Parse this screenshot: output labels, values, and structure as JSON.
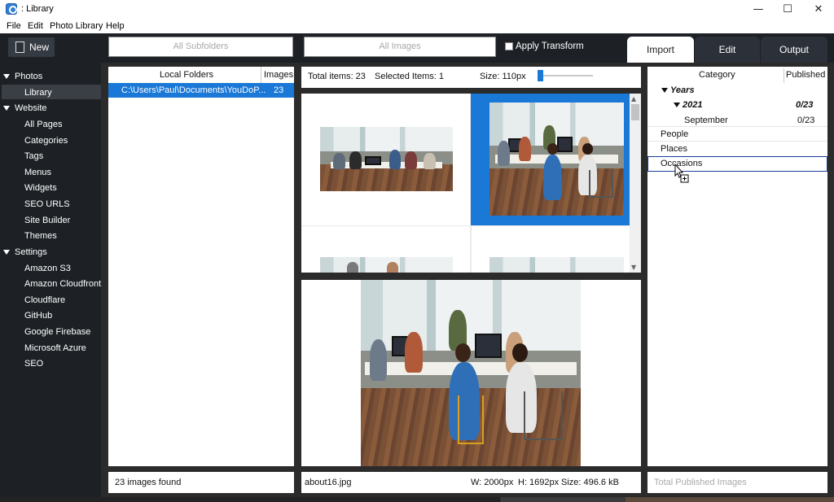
{
  "window": {
    "title": ": Library",
    "minimize": "—",
    "maximize": "☐",
    "close": "✕"
  },
  "menu": [
    "File",
    "Edit",
    "Photo Library",
    "Help"
  ],
  "toolbar": {
    "new_label": "New",
    "subfolders_placeholder": "All Subfolders",
    "images_placeholder": "All Images",
    "apply_transform_label": "Apply Transform",
    "apply_transform_checked": false,
    "tabs": [
      {
        "label": "Import",
        "active": true
      },
      {
        "label": "Edit",
        "active": false
      },
      {
        "label": "Output",
        "active": false
      }
    ]
  },
  "sidebar": {
    "sections": [
      {
        "label": "Photos",
        "items": [
          "Library"
        ]
      },
      {
        "label": "Website",
        "items": [
          "All Pages",
          "Categories",
          "Tags",
          "Menus",
          "Widgets",
          "SEO URLS",
          "Site Builder",
          "Themes"
        ]
      },
      {
        "label": "Settings",
        "items": [
          "Amazon S3",
          "Amazon Cloudfront",
          "Cloudflare",
          "GitHub",
          "Google Firebase",
          "Microsoft Azure",
          "SEO"
        ]
      }
    ],
    "selected_item": "Library"
  },
  "folders": {
    "header_folders": "Local Folders",
    "header_images": "Images",
    "rows": [
      {
        "path": "C:\\Users\\Paul\\Documents\\YouDoP...",
        "count": "23"
      }
    ],
    "status": "23 images found"
  },
  "gallery": {
    "total_items": "Total items: 23",
    "selected_items": "Selected Items: 1",
    "size_label": "Size: 110px",
    "size_slider_fraction": 0.05
  },
  "preview": {
    "filename": "about16.jpg",
    "width": "W: 2000px",
    "height": "H: 1692px",
    "size": "Size: 496.6 kB"
  },
  "categories": {
    "header_category": "Category",
    "header_published": "Published",
    "years_label": "Years",
    "year": "2021",
    "year_count": "0/23",
    "month": "September",
    "month_count": "0/23",
    "items": [
      "People",
      "Places",
      "Occasions"
    ],
    "status": "Total Published Images"
  },
  "colors": {
    "accent": "#1a78d6",
    "sidebar_bg": "#1d2126",
    "toolbar_bg": "#1d2126"
  }
}
